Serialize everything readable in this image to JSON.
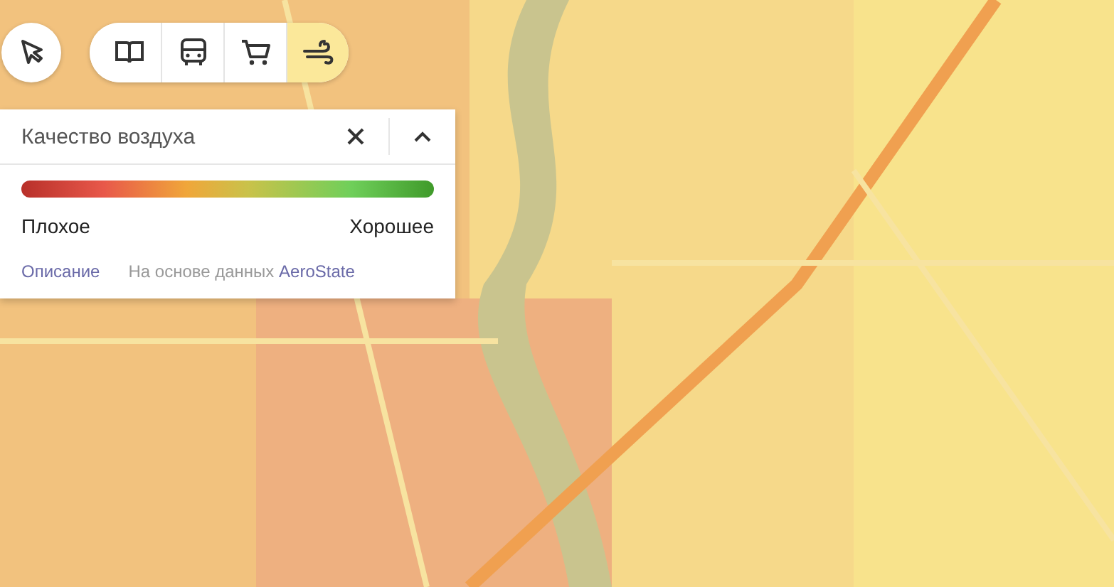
{
  "map_controls": {
    "layers": [
      {
        "kind": "book",
        "selected": false
      },
      {
        "kind": "bus",
        "selected": false
      },
      {
        "kind": "cart",
        "selected": false
      },
      {
        "kind": "wind",
        "selected": true
      }
    ]
  },
  "panel": {
    "title": "Качество воздуха",
    "expanded": true,
    "scale": {
      "low": "Плохое",
      "high": "Хорошее"
    },
    "description_link": "Описание",
    "source": {
      "text": "На основе данных",
      "link": "AeroState"
    }
  }
}
